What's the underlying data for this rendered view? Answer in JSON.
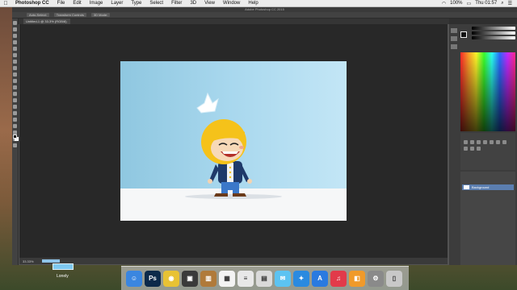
{
  "menubar": {
    "apple": "",
    "app_name": "Photoshop CC",
    "items": [
      "File",
      "Edit",
      "Image",
      "Layer",
      "Type",
      "Select",
      "Filter",
      "3D",
      "View",
      "Window",
      "Help"
    ],
    "battery": "100%",
    "clock": "Thu 01:57"
  },
  "window": {
    "title": "Adobe Photoshop CC 2015"
  },
  "options_bar": {
    "items": [
      "Auto-Select:",
      "Transform Controls",
      "3D Mode:"
    ]
  },
  "document": {
    "tab_label": "Untitled-1 @ 33.3% (RGB/8)"
  },
  "status": {
    "zoom": "33.33%"
  },
  "layers": {
    "background_label": "Background"
  },
  "desktop": {
    "file_label": "Lonely"
  },
  "dock": {
    "icons": [
      {
        "name": "finder-icon",
        "glyph": "☺",
        "color": "#3a86e0"
      },
      {
        "name": "photoshop-icon",
        "glyph": "Ps",
        "color": "#0c2a4a"
      },
      {
        "name": "chrome-icon",
        "glyph": "◉",
        "color": "#e8c234"
      },
      {
        "name": "photo-icon",
        "glyph": "▣",
        "color": "#3a3a3a"
      },
      {
        "name": "books-icon",
        "glyph": "▥",
        "color": "#b07a3a"
      },
      {
        "name": "calendar-icon",
        "glyph": "▦",
        "color": "#f3f3f3"
      },
      {
        "name": "notes-icon",
        "glyph": "≡",
        "color": "#e8e8e8"
      },
      {
        "name": "preview-icon",
        "glyph": "▤",
        "color": "#dadada"
      },
      {
        "name": "messages-icon",
        "glyph": "✉",
        "color": "#5cc3f2"
      },
      {
        "name": "safari-icon",
        "glyph": "✦",
        "color": "#2a8ae0"
      },
      {
        "name": "appstore-icon",
        "glyph": "A",
        "color": "#2a7ae0"
      },
      {
        "name": "music-icon",
        "glyph": "♫",
        "color": "#e23a4a"
      },
      {
        "name": "ibooks-icon",
        "glyph": "◧",
        "color": "#f09a2a"
      },
      {
        "name": "preferences-icon",
        "glyph": "⚙",
        "color": "#8a8a8a"
      },
      {
        "name": "trash-icon",
        "glyph": "▯",
        "color": "#c8c8c8"
      }
    ]
  },
  "colors": {
    "sky": "#a9d8ee",
    "hair": "#f5c21a",
    "jacket": "#1f3a6a"
  }
}
